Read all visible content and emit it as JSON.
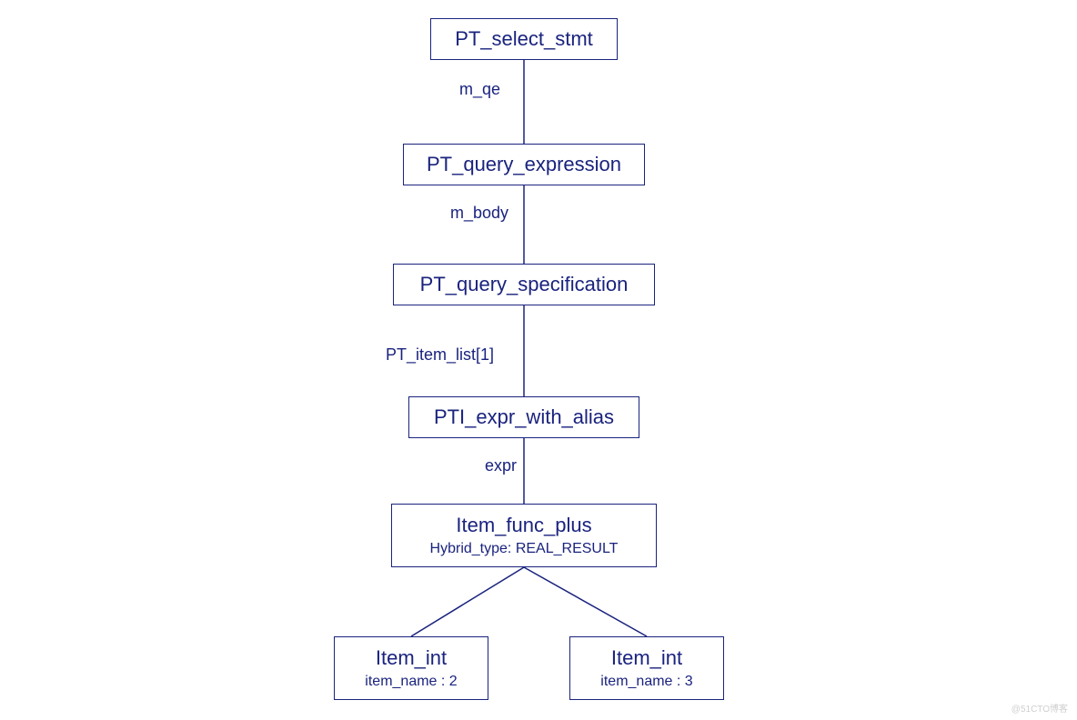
{
  "nodes": {
    "n1": {
      "title": "PT_select_stmt"
    },
    "n2": {
      "title": "PT_query_expression"
    },
    "n3": {
      "title": "PT_query_specification"
    },
    "n4": {
      "title": "PTI_expr_with_alias"
    },
    "n5": {
      "title": "Item_func_plus",
      "sub": "Hybrid_type: REAL_RESULT"
    },
    "n6": {
      "title": "Item_int",
      "sub": "item_name : 2"
    },
    "n7": {
      "title": "Item_int",
      "sub": "item_name : 3"
    }
  },
  "edges": {
    "e1": "m_qe",
    "e2": "m_body",
    "e3": "PT_item_list[1]",
    "e4": "expr"
  },
  "watermark": "@51CTO博客"
}
